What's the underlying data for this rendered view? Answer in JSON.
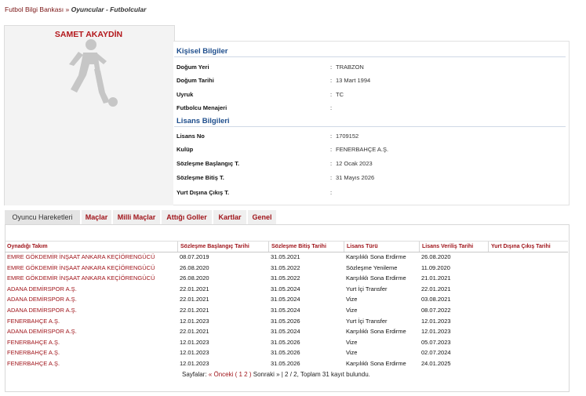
{
  "breadcrumb": {
    "root": "Futbol Bilgi Bankası",
    "separator": " » ",
    "current": "Oyuncular - Futbolcular"
  },
  "player": {
    "name": "SAMET AKAYDİN",
    "photo_icon": "player-silhouette-icon"
  },
  "personal": {
    "title": "Kişisel Bilgiler",
    "rows": [
      {
        "label": "Doğum Yeri",
        "value": "TRABZON"
      },
      {
        "label": "Doğum Tarihi",
        "value": "13 Mart 1994"
      },
      {
        "label": "Uyruk",
        "value": "TC"
      },
      {
        "label": "Futbolcu Menajeri",
        "value": ""
      }
    ]
  },
  "license": {
    "title": "Lisans Bilgileri",
    "rows": [
      {
        "label": "Lisans No",
        "value": "1709152"
      },
      {
        "label": "Kulüp",
        "value": "FENERBAHÇE A.Ş."
      },
      {
        "label": "Sözleşme Başlangıç T.",
        "value": "12 Ocak 2023"
      },
      {
        "label": "Sözleşme Bitiş T.",
        "value": "31 Mayıs 2026"
      },
      {
        "label": "Yurt Dışına Çıkış T.",
        "value": ""
      }
    ]
  },
  "colon": ":",
  "tabs": [
    {
      "label": "Oyuncu Hareketleri",
      "active": true
    },
    {
      "label": "Maçlar",
      "active": false
    },
    {
      "label": "Milli Maçlar",
      "active": false
    },
    {
      "label": "Attığı Goller",
      "active": false
    },
    {
      "label": "Kartlar",
      "active": false
    },
    {
      "label": "Genel",
      "active": false
    }
  ],
  "grid": {
    "columns": [
      "Oynadığı Takım",
      "Sözleşme Başlangıç Tarihi",
      "Sözleşme Bitiş Tarihi",
      "Lisans Türü",
      "Lisans Veriliş Tarihi",
      "Yurt Dışına Çıkış Tarihi"
    ],
    "rows": [
      [
        "EMRE GÖKDEMİR İNŞAAT ANKARA KEÇİÖRENGÜCÜ",
        "08.07.2019",
        "31.05.2021",
        "Karşılıklı Sona Erdirme",
        "26.08.2020",
        ""
      ],
      [
        "EMRE GÖKDEMİR İNŞAAT ANKARA KEÇİÖRENGÜCÜ",
        "26.08.2020",
        "31.05.2022",
        "Sözleşme Yenileme",
        "11.09.2020",
        ""
      ],
      [
        "EMRE GÖKDEMİR İNŞAAT ANKARA KEÇİÖRENGÜCÜ",
        "26.08.2020",
        "31.05.2022",
        "Karşılıklı Sona Erdirme",
        "21.01.2021",
        ""
      ],
      [
        "ADANA DEMİRSPOR A.Ş.",
        "22.01.2021",
        "31.05.2024",
        "Yurt İçi Transfer",
        "22.01.2021",
        ""
      ],
      [
        "ADANA DEMİRSPOR A.Ş.",
        "22.01.2021",
        "31.05.2024",
        "Vize",
        "03.08.2021",
        ""
      ],
      [
        "ADANA DEMİRSPOR A.Ş.",
        "22.01.2021",
        "31.05.2024",
        "Vize",
        "08.07.2022",
        ""
      ],
      [
        "FENERBAHÇE A.Ş.",
        "12.01.2023",
        "31.05.2026",
        "Yurt İçi Transfer",
        "12.01.2023",
        ""
      ],
      [
        "ADANA DEMİRSPOR A.Ş.",
        "22.01.2021",
        "31.05.2024",
        "Karşılıklı Sona Erdirme",
        "12.01.2023",
        ""
      ],
      [
        "FENERBAHÇE A.Ş.",
        "12.01.2023",
        "31.05.2026",
        "Vize",
        "05.07.2023",
        ""
      ],
      [
        "FENERBAHÇE A.Ş.",
        "12.01.2023",
        "31.05.2026",
        "Vize",
        "02.07.2024",
        ""
      ],
      [
        "FENERBAHÇE A.Ş.",
        "12.01.2023",
        "31.05.2026",
        "Karşılıklı Sona Erdirme",
        "24.01.2025",
        ""
      ]
    ]
  },
  "pager": {
    "prefix": "Sayfalar: ",
    "prev": "« Önceki",
    "open": " ( ",
    "page1": "1",
    "page2": "2",
    "close": " ) ",
    "next": "Sonraki »",
    "summary": " | 2 / 2, Toplam 31 kayıt bulundu."
  },
  "colors": {
    "brand_red": "#a0151b",
    "section_blue": "#1d4d8c"
  }
}
